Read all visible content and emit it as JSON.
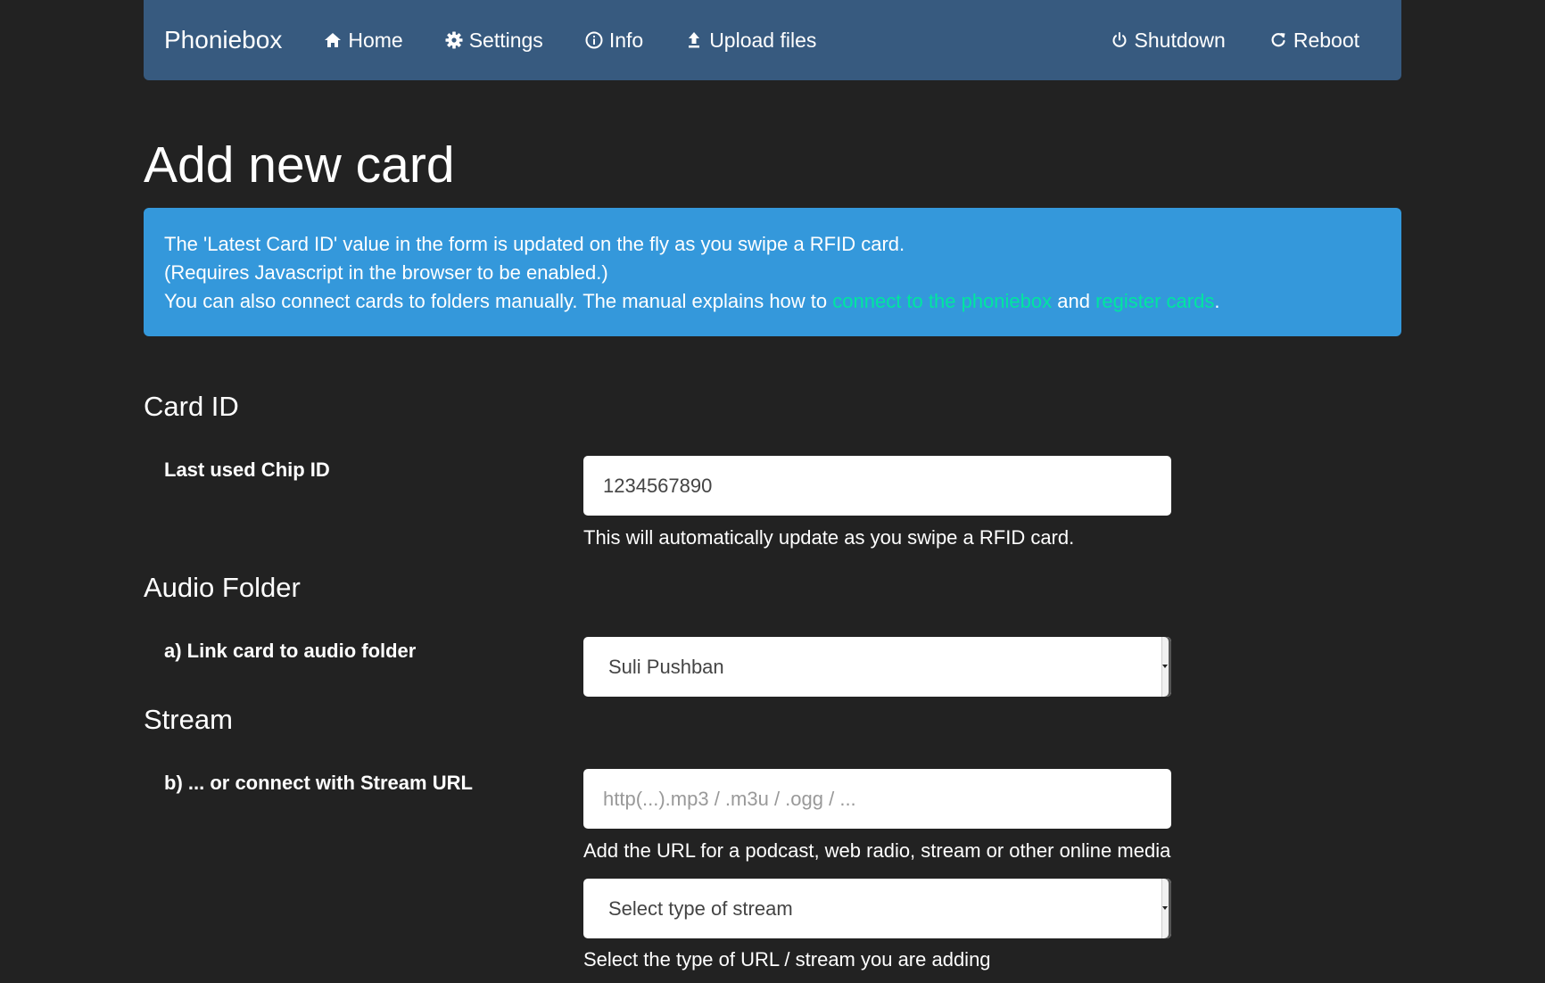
{
  "navbar": {
    "brand": "Phoniebox",
    "links": [
      {
        "label": "Home",
        "icon": "home-icon"
      },
      {
        "label": "Settings",
        "icon": "gear-icon"
      },
      {
        "label": "Info",
        "icon": "info-icon"
      },
      {
        "label": "Upload files",
        "icon": "upload-icon"
      }
    ],
    "right_links": [
      {
        "label": "Shutdown",
        "icon": "power-icon"
      },
      {
        "label": "Reboot",
        "icon": "refresh-icon"
      }
    ]
  },
  "page": {
    "title": "Add new card"
  },
  "alert": {
    "line1": "The 'Latest Card ID' value in the form is updated on the fly as you swipe a RFID card.",
    "line2": "(Requires Javascript in the browser to be enabled.)",
    "line3_prefix": "You can also connect cards to folders manually. The manual explains how to ",
    "link1": "connect to the phoniebox",
    "and": " and ",
    "link2": "register cards",
    "suffix": "."
  },
  "card_id": {
    "section_title": "Card ID",
    "label": "Last used Chip ID",
    "value": "1234567890",
    "help": "This will automatically update as you swipe a RFID card."
  },
  "audio_folder": {
    "section_title": "Audio Folder",
    "label": "a) Link card to audio folder",
    "selected": "Suli Pushban"
  },
  "stream": {
    "section_title": "Stream",
    "label": "b) ... or connect with Stream URL",
    "placeholder": "http(...).mp3 / .m3u / .ogg / ...",
    "help": "Add the URL for a podcast, web radio, stream or other online media",
    "type_selected": "Select type of stream",
    "type_help": "Select the type of URL / stream you are adding"
  },
  "colors": {
    "background": "#222222",
    "navbar": "#375a7f",
    "alert": "#3498db",
    "link": "#00e6a0"
  }
}
